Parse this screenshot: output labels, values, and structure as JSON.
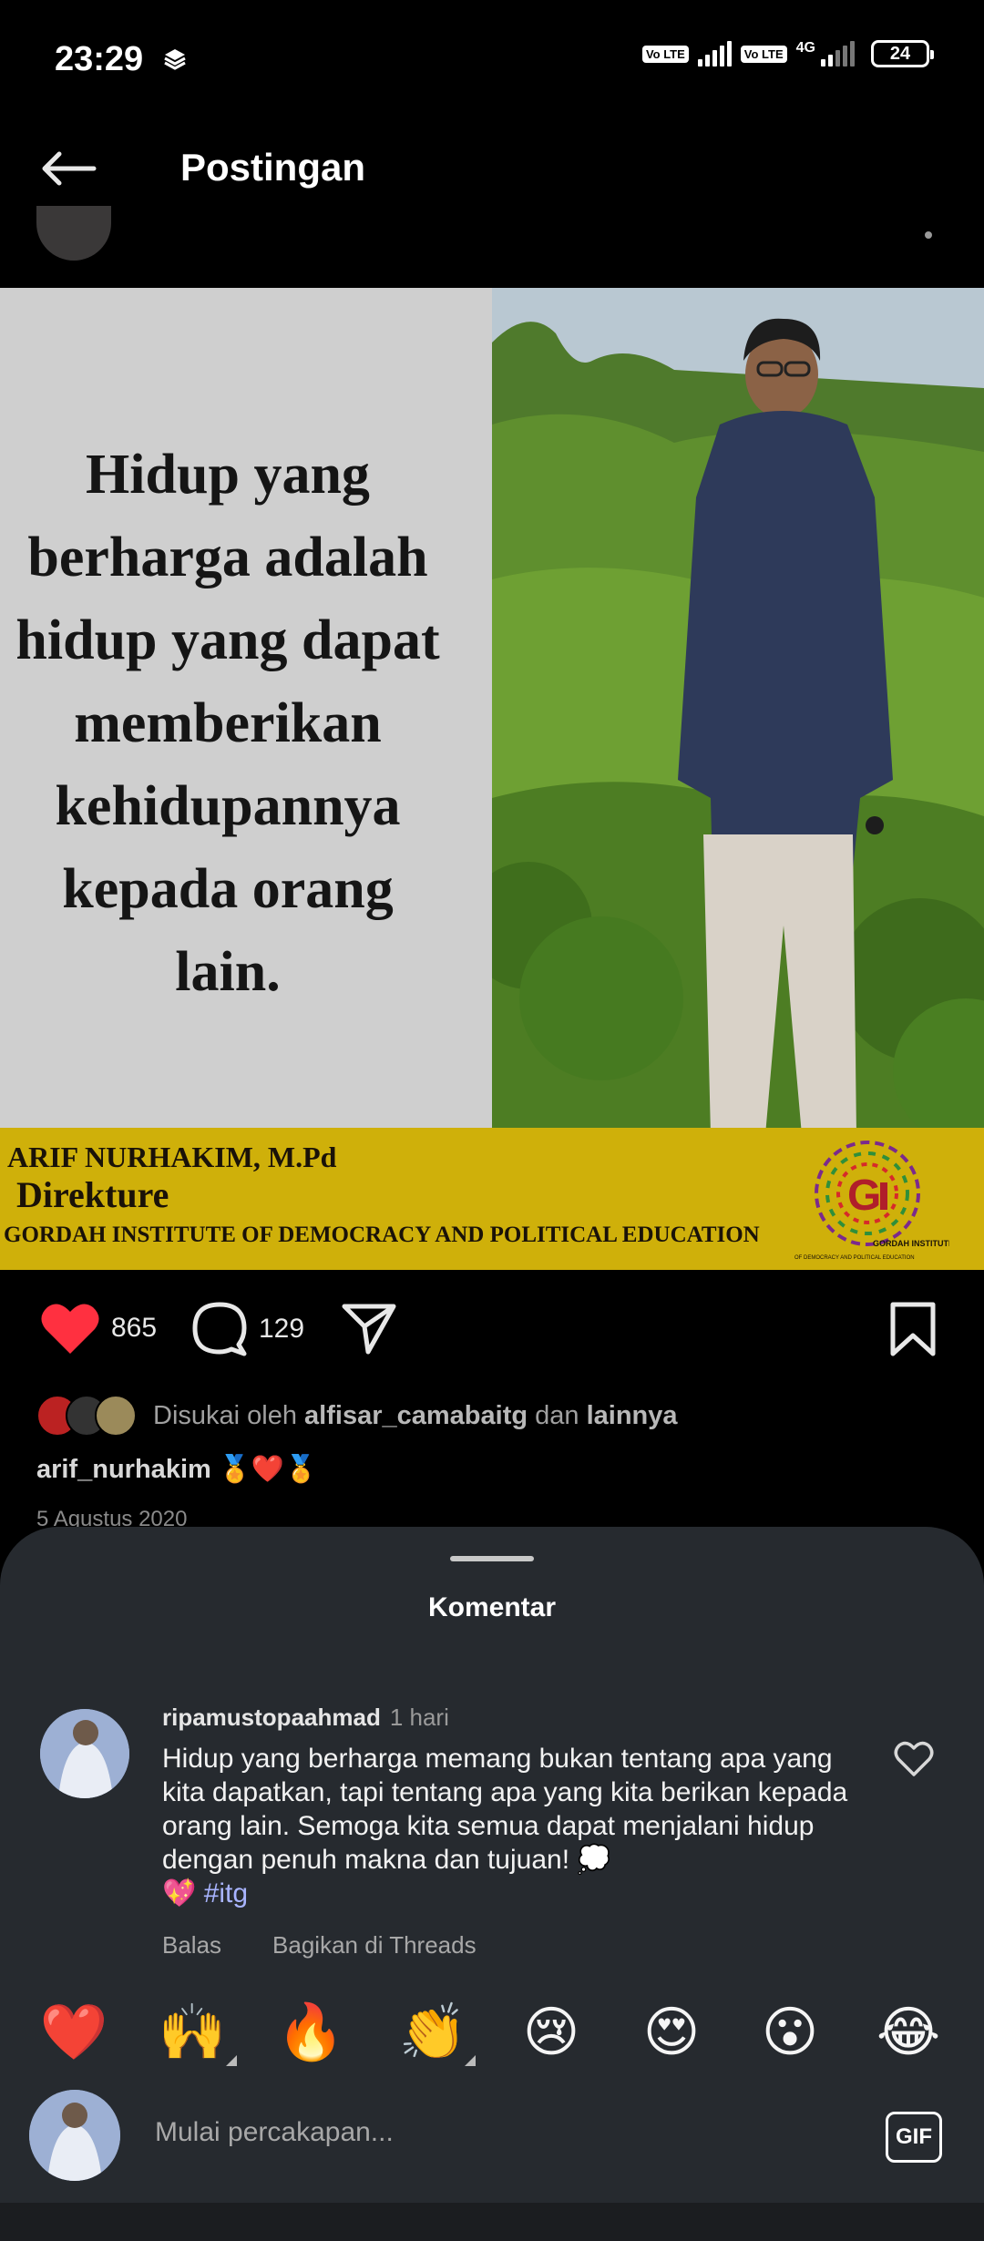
{
  "status_bar": {
    "time": "23:29",
    "volte1": "Vo LTE",
    "volte2": "Vo LTE",
    "network": "4G",
    "battery": "24"
  },
  "header": {
    "title": "Postingan",
    "back_icon": "arrow-left-icon"
  },
  "post": {
    "quote_lines": [
      "Hidup yang",
      "berharga adalah",
      "hidup yang dapat",
      "memberikan",
      "kehidupannya",
      "kepada orang",
      "lain."
    ],
    "banner_name": "ARIF NURHAKIM, M.Pd",
    "banner_role": "Direkture",
    "banner_org": "GORDAH INSTITUTE OF DEMOCRACY AND POLITICAL EDUCATION",
    "logo_text": "GORDAH INSTITUTE",
    "logo_subtext": "OF DEMOCRACY AND POLITICAL EDUCATION",
    "brand_colors": {
      "banner": "#cfb00a",
      "panel": "#cfcfcf"
    }
  },
  "actions": {
    "likes": "865",
    "comments": "129",
    "like_icon": "heart-filled-icon",
    "comment_icon": "comment-bubble-icon",
    "share_icon": "paper-plane-icon",
    "save_icon": "bookmark-icon",
    "like_color": "#ff3040"
  },
  "liked_by": {
    "prefix": "Disukai oleh",
    "user": "alfisar_camabaitg",
    "joiner": "dan",
    "suffix": "lainnya"
  },
  "caption": {
    "username": "arif_nurhakim",
    "emojis": "🏅❤️🏅"
  },
  "date": "5 Agustus 2020",
  "comments_sheet": {
    "title": "Komentar",
    "comment": {
      "username": "ripamustopaahmad",
      "time": "1 hari",
      "text": "Hidup yang berharga memang bukan tentang apa yang kita dapatkan, tapi tentang apa yang kita berikan kepada orang lain. Semoga kita semua dapat menjalani hidup dengan penuh makna dan tujuan! 💭",
      "text_line2": "💖",
      "hashtag": "#itg",
      "reply": "Balas",
      "share": "Bagikan di Threads"
    },
    "emojis": [
      "❤️",
      "🙌",
      "🔥",
      "👏",
      "😢",
      "😍",
      "😮",
      "😂"
    ],
    "input_placeholder": "Mulai percakapan...",
    "gif_label": "GIF"
  }
}
